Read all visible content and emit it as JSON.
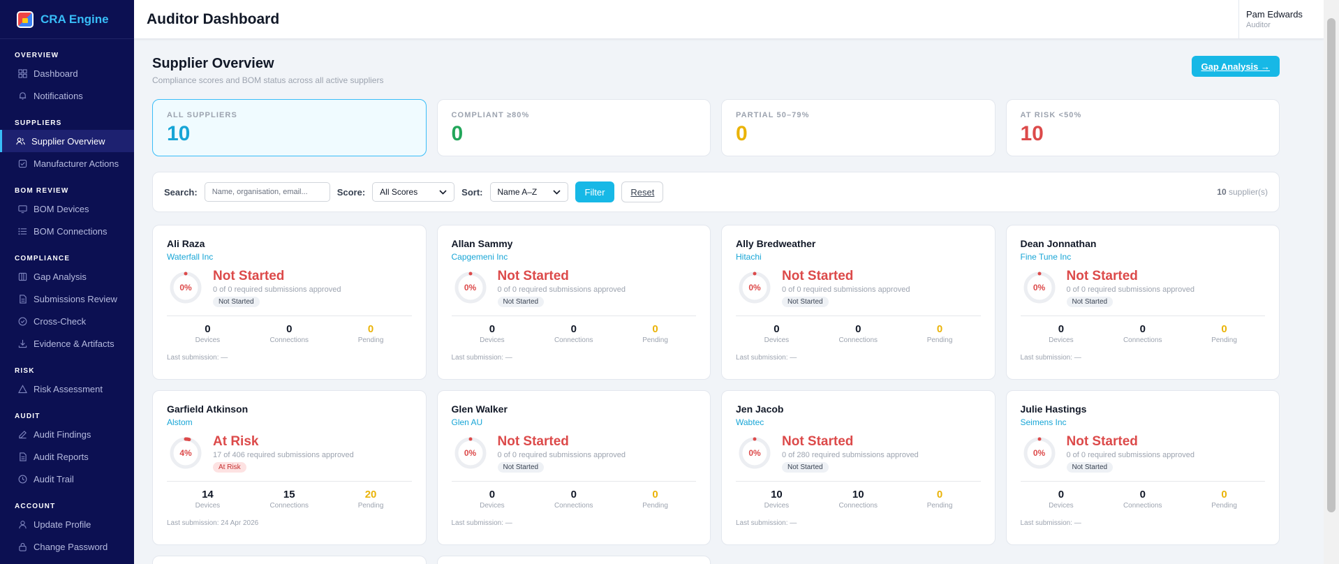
{
  "app": {
    "name": "CRA Engine"
  },
  "header": {
    "title": "Auditor Dashboard",
    "user_name": "Pam Edwards",
    "user_role": "Auditor"
  },
  "sidebar": {
    "sections": [
      {
        "heading": "OVERVIEW",
        "items": [
          {
            "label": "Dashboard",
            "icon": "grid-icon"
          },
          {
            "label": "Notifications",
            "icon": "bell-icon"
          }
        ]
      },
      {
        "heading": "SUPPLIERS",
        "items": [
          {
            "label": "Supplier Overview",
            "icon": "users-icon",
            "active": true
          },
          {
            "label": "Manufacturer Actions",
            "icon": "check-square-icon"
          }
        ]
      },
      {
        "heading": "BOM REVIEW",
        "items": [
          {
            "label": "BOM Devices",
            "icon": "monitor-icon"
          },
          {
            "label": "BOM Connections",
            "icon": "list-icon"
          }
        ]
      },
      {
        "heading": "COMPLIANCE",
        "items": [
          {
            "label": "Gap Analysis",
            "icon": "columns-icon"
          },
          {
            "label": "Submissions Review",
            "icon": "file-icon"
          },
          {
            "label": "Cross-Check",
            "icon": "check-circle-icon"
          },
          {
            "label": "Evidence & Artifacts",
            "icon": "download-icon"
          }
        ]
      },
      {
        "heading": "RISK",
        "items": [
          {
            "label": "Risk Assessment",
            "icon": "warning-icon"
          }
        ]
      },
      {
        "heading": "AUDIT",
        "items": [
          {
            "label": "Audit Findings",
            "icon": "edit-icon"
          },
          {
            "label": "Audit Reports",
            "icon": "file-icon"
          },
          {
            "label": "Audit Trail",
            "icon": "clock-icon"
          }
        ]
      },
      {
        "heading": "ACCOUNT",
        "items": [
          {
            "label": "Update Profile",
            "icon": "user-icon"
          },
          {
            "label": "Change Password",
            "icon": "lock-icon"
          }
        ]
      }
    ]
  },
  "overview": {
    "title": "Supplier Overview",
    "subtitle": "Compliance scores and BOM status across all active suppliers",
    "gap_button": "Gap Analysis →"
  },
  "stats": [
    {
      "label": "ALL SUPPLIERS",
      "value": "10",
      "color": "#17a5d6"
    },
    {
      "label": "COMPLIANT ≥80%",
      "value": "0",
      "color": "#22a65a"
    },
    {
      "label": "PARTIAL 50–79%",
      "value": "0",
      "color": "#eab308"
    },
    {
      "label": "AT RISK <50%",
      "value": "10",
      "color": "#dc4a4a"
    }
  ],
  "filters": {
    "search_label": "Search:",
    "search_placeholder": "Name, organisation, email...",
    "score_label": "Score:",
    "score_value": "All Scores",
    "sort_label": "Sort:",
    "sort_value": "Name A–Z",
    "filter_button": "Filter",
    "reset_button": "Reset",
    "count_number": "10",
    "count_suffix": " supplier(s)"
  },
  "card_labels": {
    "devices": "Devices",
    "connections": "Connections",
    "pending": "Pending"
  },
  "suppliers": [
    {
      "name": "Ali Raza",
      "org": "Waterfall Inc",
      "percent": 0,
      "percent_text": "0%",
      "status": "Not Started",
      "desc": "0 of 0 required submissions approved",
      "badge": "Not Started",
      "devices": "0",
      "connections": "0",
      "pending": "0",
      "last": "Last submission: —"
    },
    {
      "name": "Allan Sammy",
      "org": "Capgemeni Inc",
      "percent": 0,
      "percent_text": "0%",
      "status": "Not Started",
      "desc": "0 of 0 required submissions approved",
      "badge": "Not Started",
      "devices": "0",
      "connections": "0",
      "pending": "0",
      "last": "Last submission: —"
    },
    {
      "name": "Ally Bredweather",
      "org": "Hitachi",
      "percent": 0,
      "percent_text": "0%",
      "status": "Not Started",
      "desc": "0 of 0 required submissions approved",
      "badge": "Not Started",
      "devices": "0",
      "connections": "0",
      "pending": "0",
      "last": "Last submission: —"
    },
    {
      "name": "Dean Jonnathan",
      "org": "Fine Tune Inc",
      "percent": 0,
      "percent_text": "0%",
      "status": "Not Started",
      "desc": "0 of 0 required submissions approved",
      "badge": "Not Started",
      "devices": "0",
      "connections": "0",
      "pending": "0",
      "last": "Last submission: —"
    },
    {
      "name": "Garfield Atkinson",
      "org": "Alstom",
      "percent": 4,
      "percent_text": "4%",
      "status": "At Risk",
      "desc": "17 of 406 required submissions approved",
      "badge": "At Risk",
      "risk": true,
      "devices": "14",
      "connections": "15",
      "pending": "20",
      "last": "Last submission: 24 Apr 2026"
    },
    {
      "name": "Glen Walker",
      "org": "Glen AU",
      "percent": 0,
      "percent_text": "0%",
      "status": "Not Started",
      "desc": "0 of 0 required submissions approved",
      "badge": "Not Started",
      "devices": "0",
      "connections": "0",
      "pending": "0",
      "last": "Last submission: —"
    },
    {
      "name": "Jen Jacob",
      "org": "Wabtec",
      "percent": 0,
      "percent_text": "0%",
      "status": "Not Started",
      "desc": "0 of 280 required submissions approved",
      "badge": "Not Started",
      "devices": "10",
      "connections": "10",
      "pending": "0",
      "last": "Last submission: —"
    },
    {
      "name": "Julie Hastings",
      "org": "Seimens Inc",
      "percent": 0,
      "percent_text": "0%",
      "status": "Not Started",
      "desc": "0 of 0 required submissions approved",
      "badge": "Not Started",
      "devices": "0",
      "connections": "0",
      "pending": "0",
      "last": "Last submission: —"
    }
  ]
}
